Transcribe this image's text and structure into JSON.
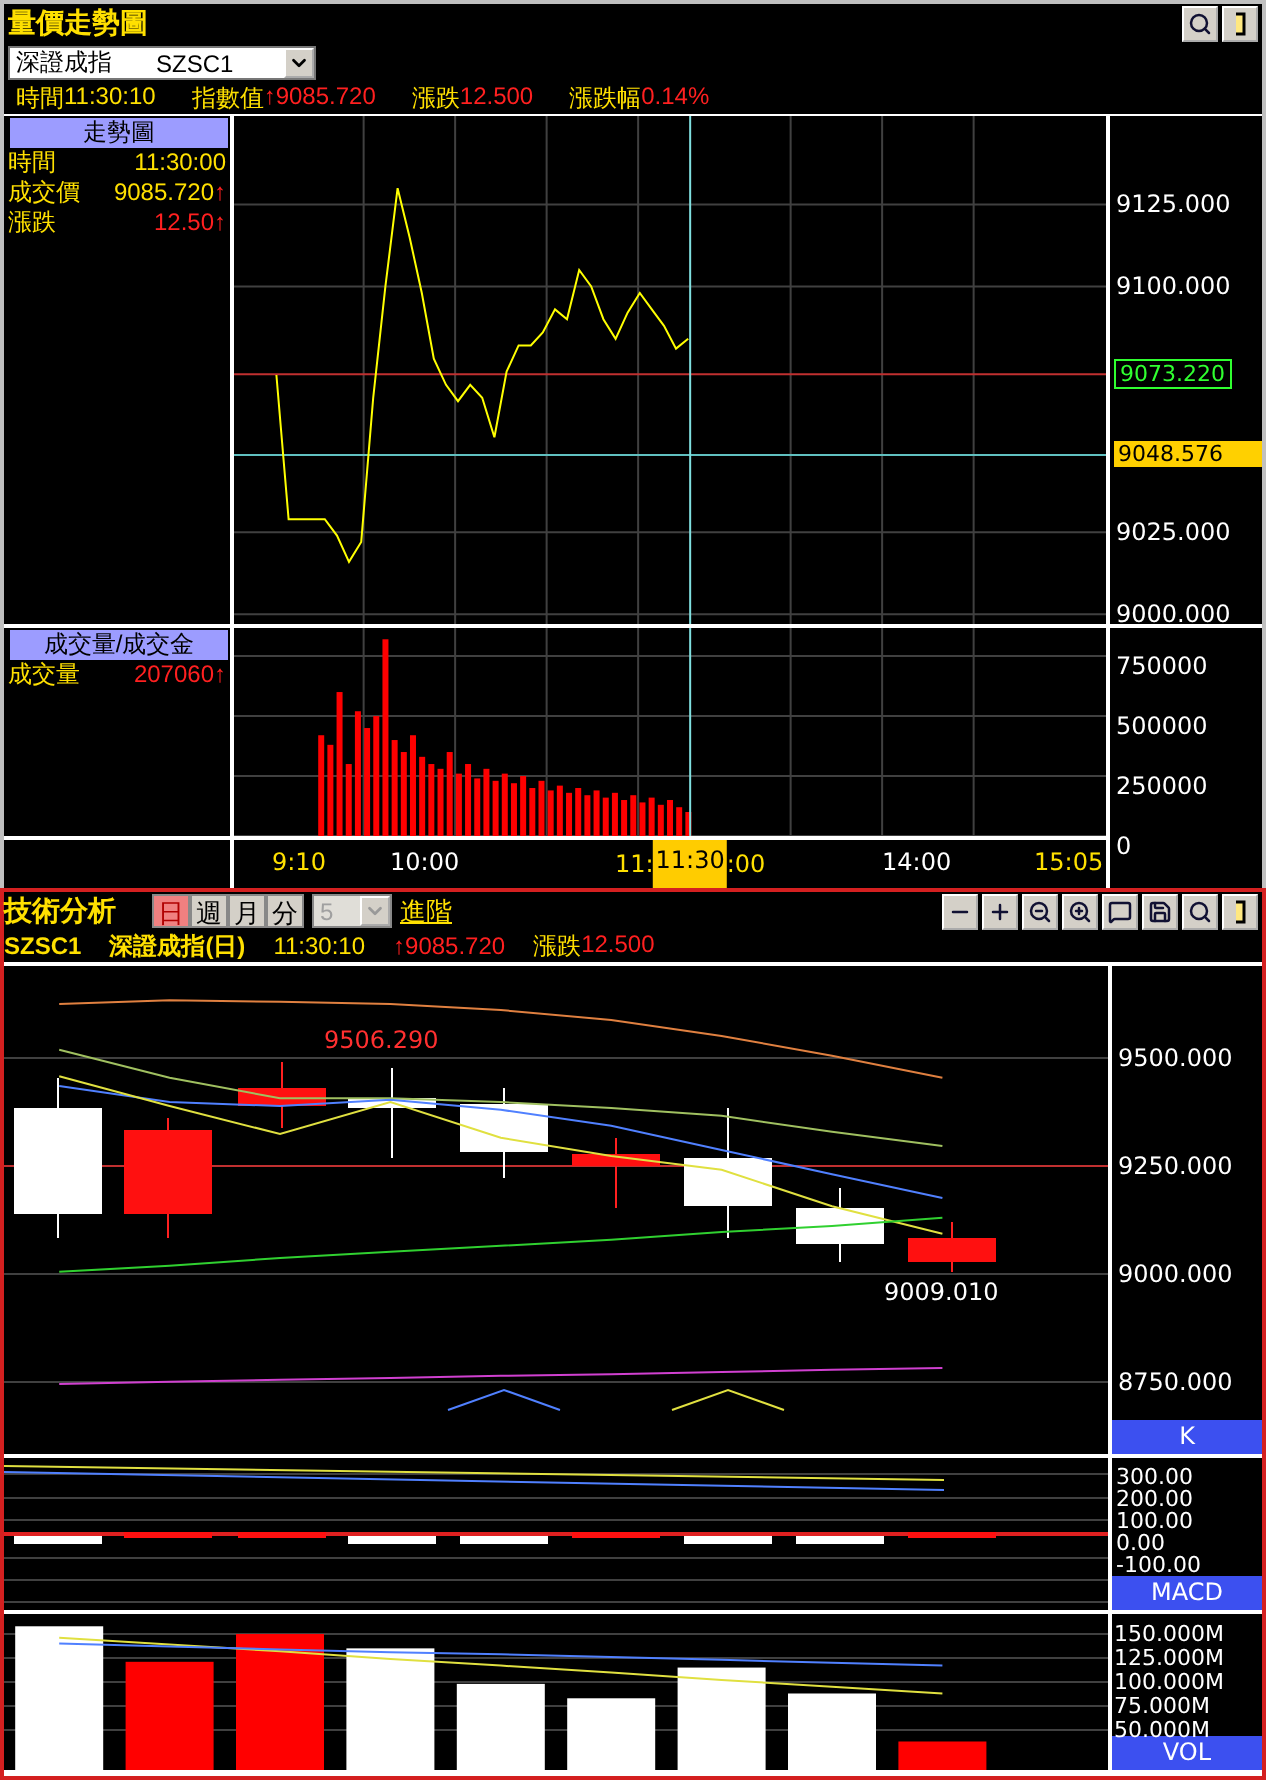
{
  "window": {
    "title": "量價走勢圖"
  },
  "index_select": {
    "name": "深證成指",
    "code": "SZSC1"
  },
  "quote_info": [
    {
      "label": "時間",
      "value": "11:30:10",
      "color": "#ffe000"
    },
    {
      "label": "指數值",
      "value": "↑9085.720",
      "color": "#ff2020"
    },
    {
      "label": "漲跌",
      "value": "12.500",
      "color": "#ff2020"
    },
    {
      "label": "漲跌幅",
      "value": "0.14%",
      "color": "#ff2020"
    }
  ],
  "price_legend": {
    "title": "走勢圖",
    "rows": [
      {
        "label": "時間",
        "value": "11:30:00",
        "color": "#ffe000"
      },
      {
        "label": "成交價",
        "value": "9085.720",
        "arrow": "↑",
        "color": "#ffe000"
      },
      {
        "label": "漲跌",
        "value": "12.50",
        "arrow": "↑",
        "color": "#ff2020"
      }
    ]
  },
  "volume_legend": {
    "title": "成交量/成交金",
    "rows": [
      {
        "label": "成交量",
        "value": "207060",
        "arrow": "↑",
        "color": "#ff2020"
      }
    ]
  },
  "price_chart": {
    "chart_data": {
      "type": "line",
      "grid": true,
      "ylim": [
        8997,
        9152
      ],
      "categories": [
        null,
        null,
        null,
        null,
        null,
        null,
        null,
        null,
        null,
        null,
        null,
        null,
        null,
        null,
        null,
        null,
        null,
        null,
        null,
        null,
        null,
        null,
        null,
        null,
        null,
        null,
        null,
        null,
        null,
        null,
        null,
        null,
        null,
        null,
        null,
        null,
        null,
        null,
        null,
        null,
        null,
        null,
        null,
        null,
        null,
        null,
        null,
        null,
        null,
        null,
        null,
        null,
        null,
        null,
        null,
        null,
        null,
        null,
        null,
        null,
        null,
        null,
        null,
        null,
        null,
        null,
        null,
        null,
        null,
        null,
        null,
        null
      ],
      "yticks": [
        {
          "value": 9000,
          "label": "9000.000"
        },
        {
          "value": 9025,
          "label": "9025.000"
        },
        {
          "value": 9100,
          "label": "9100.000"
        },
        {
          "value": 9125,
          "label": "9125.000"
        }
      ],
      "series": [
        {
          "color": "#ffff00",
          "values": [
            null,
            null,
            null,
            9073,
            9029,
            9029,
            9029,
            9029,
            9024,
            9016,
            9022,
            9066,
            9100,
            9130,
            9115,
            9098,
            9078,
            9070,
            9065,
            9070,
            9066,
            9054,
            9074,
            9082,
            9082,
            9086,
            9093,
            9090,
            9105,
            9100,
            9090,
            9084,
            9092,
            9098,
            9093,
            9088,
            9081,
            9084,
            null,
            null,
            null,
            null,
            null,
            null,
            null,
            null,
            null,
            null,
            null,
            null,
            null,
            null,
            null,
            null,
            null,
            null,
            null,
            null,
            null,
            null,
            null,
            null,
            null,
            null,
            null,
            null,
            null,
            null,
            null,
            null,
            null,
            null
          ]
        }
      ],
      "ref_lines": [
        {
          "axis": "y",
          "value": 9073.22,
          "label": "9073.220",
          "color": "#c03030"
        },
        {
          "axis": "y",
          "value": 9048.576,
          "label": "9048.576",
          "color": "#60c0c0"
        }
      ]
    }
  },
  "volume_chart": {
    "chart_data": {
      "type": "bar",
      "grid": true,
      "ylim": [
        0,
        867000
      ],
      "categories": [
        null,
        null,
        null,
        null,
        null,
        null,
        null,
        null,
        null,
        null,
        null,
        null,
        null,
        null,
        null,
        null,
        null,
        null,
        null,
        null,
        null,
        null,
        null,
        null,
        null,
        null,
        null,
        null,
        null,
        null,
        null,
        null,
        null,
        null,
        null,
        null,
        null,
        null,
        null,
        null,
        null,
        null,
        null,
        null,
        null,
        null,
        null,
        null,
        null,
        null,
        null,
        null,
        null,
        null,
        null,
        null,
        null,
        null,
        null,
        null,
        null,
        null,
        null,
        null,
        null,
        null,
        null,
        null,
        null,
        null,
        null,
        null,
        null,
        null,
        null,
        null,
        null,
        null,
        null,
        null,
        null,
        null,
        null,
        null,
        null,
        null,
        null,
        null,
        null,
        null,
        null,
        null,
        null,
        null,
        null
      ],
      "yticks": [
        {
          "value": 0,
          "label": "0"
        },
        {
          "value": 250000,
          "label": "250000"
        },
        {
          "value": 500000,
          "label": "500000"
        },
        {
          "value": 750000,
          "label": "750000"
        }
      ],
      "series": [
        {
          "color": "#ff0000",
          "values": [
            null,
            null,
            null,
            null,
            null,
            null,
            null,
            null,
            null,
            420000,
            380000,
            600000,
            300000,
            520000,
            450000,
            500000,
            820000,
            400000,
            350000,
            420000,
            330000,
            300000,
            280000,
            350000,
            260000,
            300000,
            240000,
            280000,
            230000,
            260000,
            220000,
            250000,
            200000,
            230000,
            190000,
            210000,
            180000,
            200000,
            170000,
            190000,
            160000,
            180000,
            150000,
            170000,
            140000,
            160000,
            130000,
            150000,
            120000,
            100000,
            null,
            null,
            null,
            null,
            null,
            null,
            null,
            null,
            null,
            null,
            null,
            null,
            null,
            null,
            null,
            null,
            null,
            null,
            null,
            null,
            null,
            null,
            null,
            null,
            null,
            null,
            null,
            null,
            null,
            null,
            null,
            null,
            null,
            null,
            null,
            null,
            null,
            null,
            null,
            null,
            null,
            null,
            null,
            null,
            null
          ]
        }
      ]
    }
  },
  "time_axis": {
    "labels": [
      "9:10",
      "10:00",
      "14:00",
      "15:05"
    ],
    "cursor": {
      "label": "11:30",
      "left": "11:",
      "right": ":00"
    }
  },
  "analysis": {
    "title": "技術分析",
    "period_tabs": [
      {
        "label": "日",
        "selected": true
      },
      {
        "label": "週",
        "selected": false
      },
      {
        "label": "月",
        "selected": false
      },
      {
        "label": "分",
        "selected": false
      }
    ],
    "period_select": {
      "value": "5",
      "disabled": true
    },
    "advanced_link": "進階"
  },
  "analysis_info": {
    "code": "SZSC1",
    "name": "深證成指(日)",
    "time": "11:30:10",
    "price": "↑9085.720",
    "change_label": "漲跌",
    "change": "12.500"
  },
  "k_chart": {
    "label": "K",
    "high_label": "9506.290",
    "low_label": "9009.010",
    "chart_data": {
      "type": "line",
      "grid": true,
      "categories": [
        null,
        null,
        null,
        null,
        null,
        null,
        null,
        null,
        null,
        null
      ],
      "ylim": [
        8583,
        9713
      ],
      "yticks": [
        {
          "value": 9500,
          "label": "9500.000"
        },
        {
          "value": 9250,
          "label": "9250.000"
        },
        {
          "value": 9000,
          "label": "9000.000"
        },
        {
          "value": 8750,
          "label": "8750.000"
        }
      ],
      "series": [
        {
          "color": "#e08040",
          "values": [
            9625,
            9634,
            9630,
            9625,
            9611,
            9588,
            9551,
            9505,
            9454,
            null
          ]
        },
        {
          "color": "#a0c060",
          "values": [
            9519,
            9454,
            9407,
            9407,
            9398,
            9384,
            9366,
            9329,
            9296,
            null
          ]
        },
        {
          "color": "#5080ff",
          "values": [
            9435,
            9398,
            9389,
            9403,
            9380,
            9343,
            9287,
            9231,
            9176,
            null
          ]
        },
        {
          "color": "#e0e040",
          "values": [
            9458,
            9389,
            9324,
            9398,
            9315,
            9273,
            9241,
            9157,
            9093,
            null
          ]
        },
        {
          "color": "#30d030",
          "values": [
            9005,
            9019,
            9037,
            9051,
            9065,
            9079,
            9097,
            9111,
            9130,
            null
          ]
        },
        {
          "color": "#d040d0",
          "values": [
            8745,
            8750,
            8755,
            8759,
            8764,
            8768,
            8773,
            8778,
            8782,
            null
          ]
        }
      ],
      "ref_lines": [
        {
          "axis": "y",
          "value": 9250,
          "color": "#c03030"
        }
      ]
    }
  },
  "macd_chart": {
    "label": "MACD",
    "yticks": [
      "300.00",
      "200.00",
      "100.00",
      "0.00",
      "-100.00"
    ]
  },
  "vol_chart": {
    "label": "VOL",
    "chart_data": {
      "type": "bar",
      "grid": true,
      "categories": [
        null,
        null,
        null,
        null,
        null,
        null,
        null,
        null,
        null,
        null
      ],
      "ylim": [
        8.3,
        170.8
      ],
      "yticks": [
        {
          "value": 150,
          "label": "150.000M"
        },
        {
          "value": 125,
          "label": "125.000M"
        },
        {
          "value": 100,
          "label": "100.000M"
        },
        {
          "value": 75,
          "label": "75.000M"
        },
        {
          "value": 50,
          "label": "50.000M"
        }
      ],
      "series": [
        {
          "color": "#ffffff",
          "values": [
            158,
            null,
            null,
            135,
            98,
            83,
            115,
            88,
            null,
            null
          ]
        },
        {
          "color": "#ff0000",
          "values": [
            null,
            121,
            150,
            null,
            null,
            null,
            null,
            null,
            38,
            null
          ]
        },
        {
          "type": "line",
          "color": "#e0e040",
          "values": [
            146,
            139,
            132,
            124,
            117,
            110,
            102,
            95,
            88,
            null
          ]
        },
        {
          "type": "line",
          "color": "#5080ff",
          "values": [
            140,
            137,
            134,
            131,
            129,
            126,
            123,
            120,
            117,
            null
          ]
        }
      ]
    }
  }
}
